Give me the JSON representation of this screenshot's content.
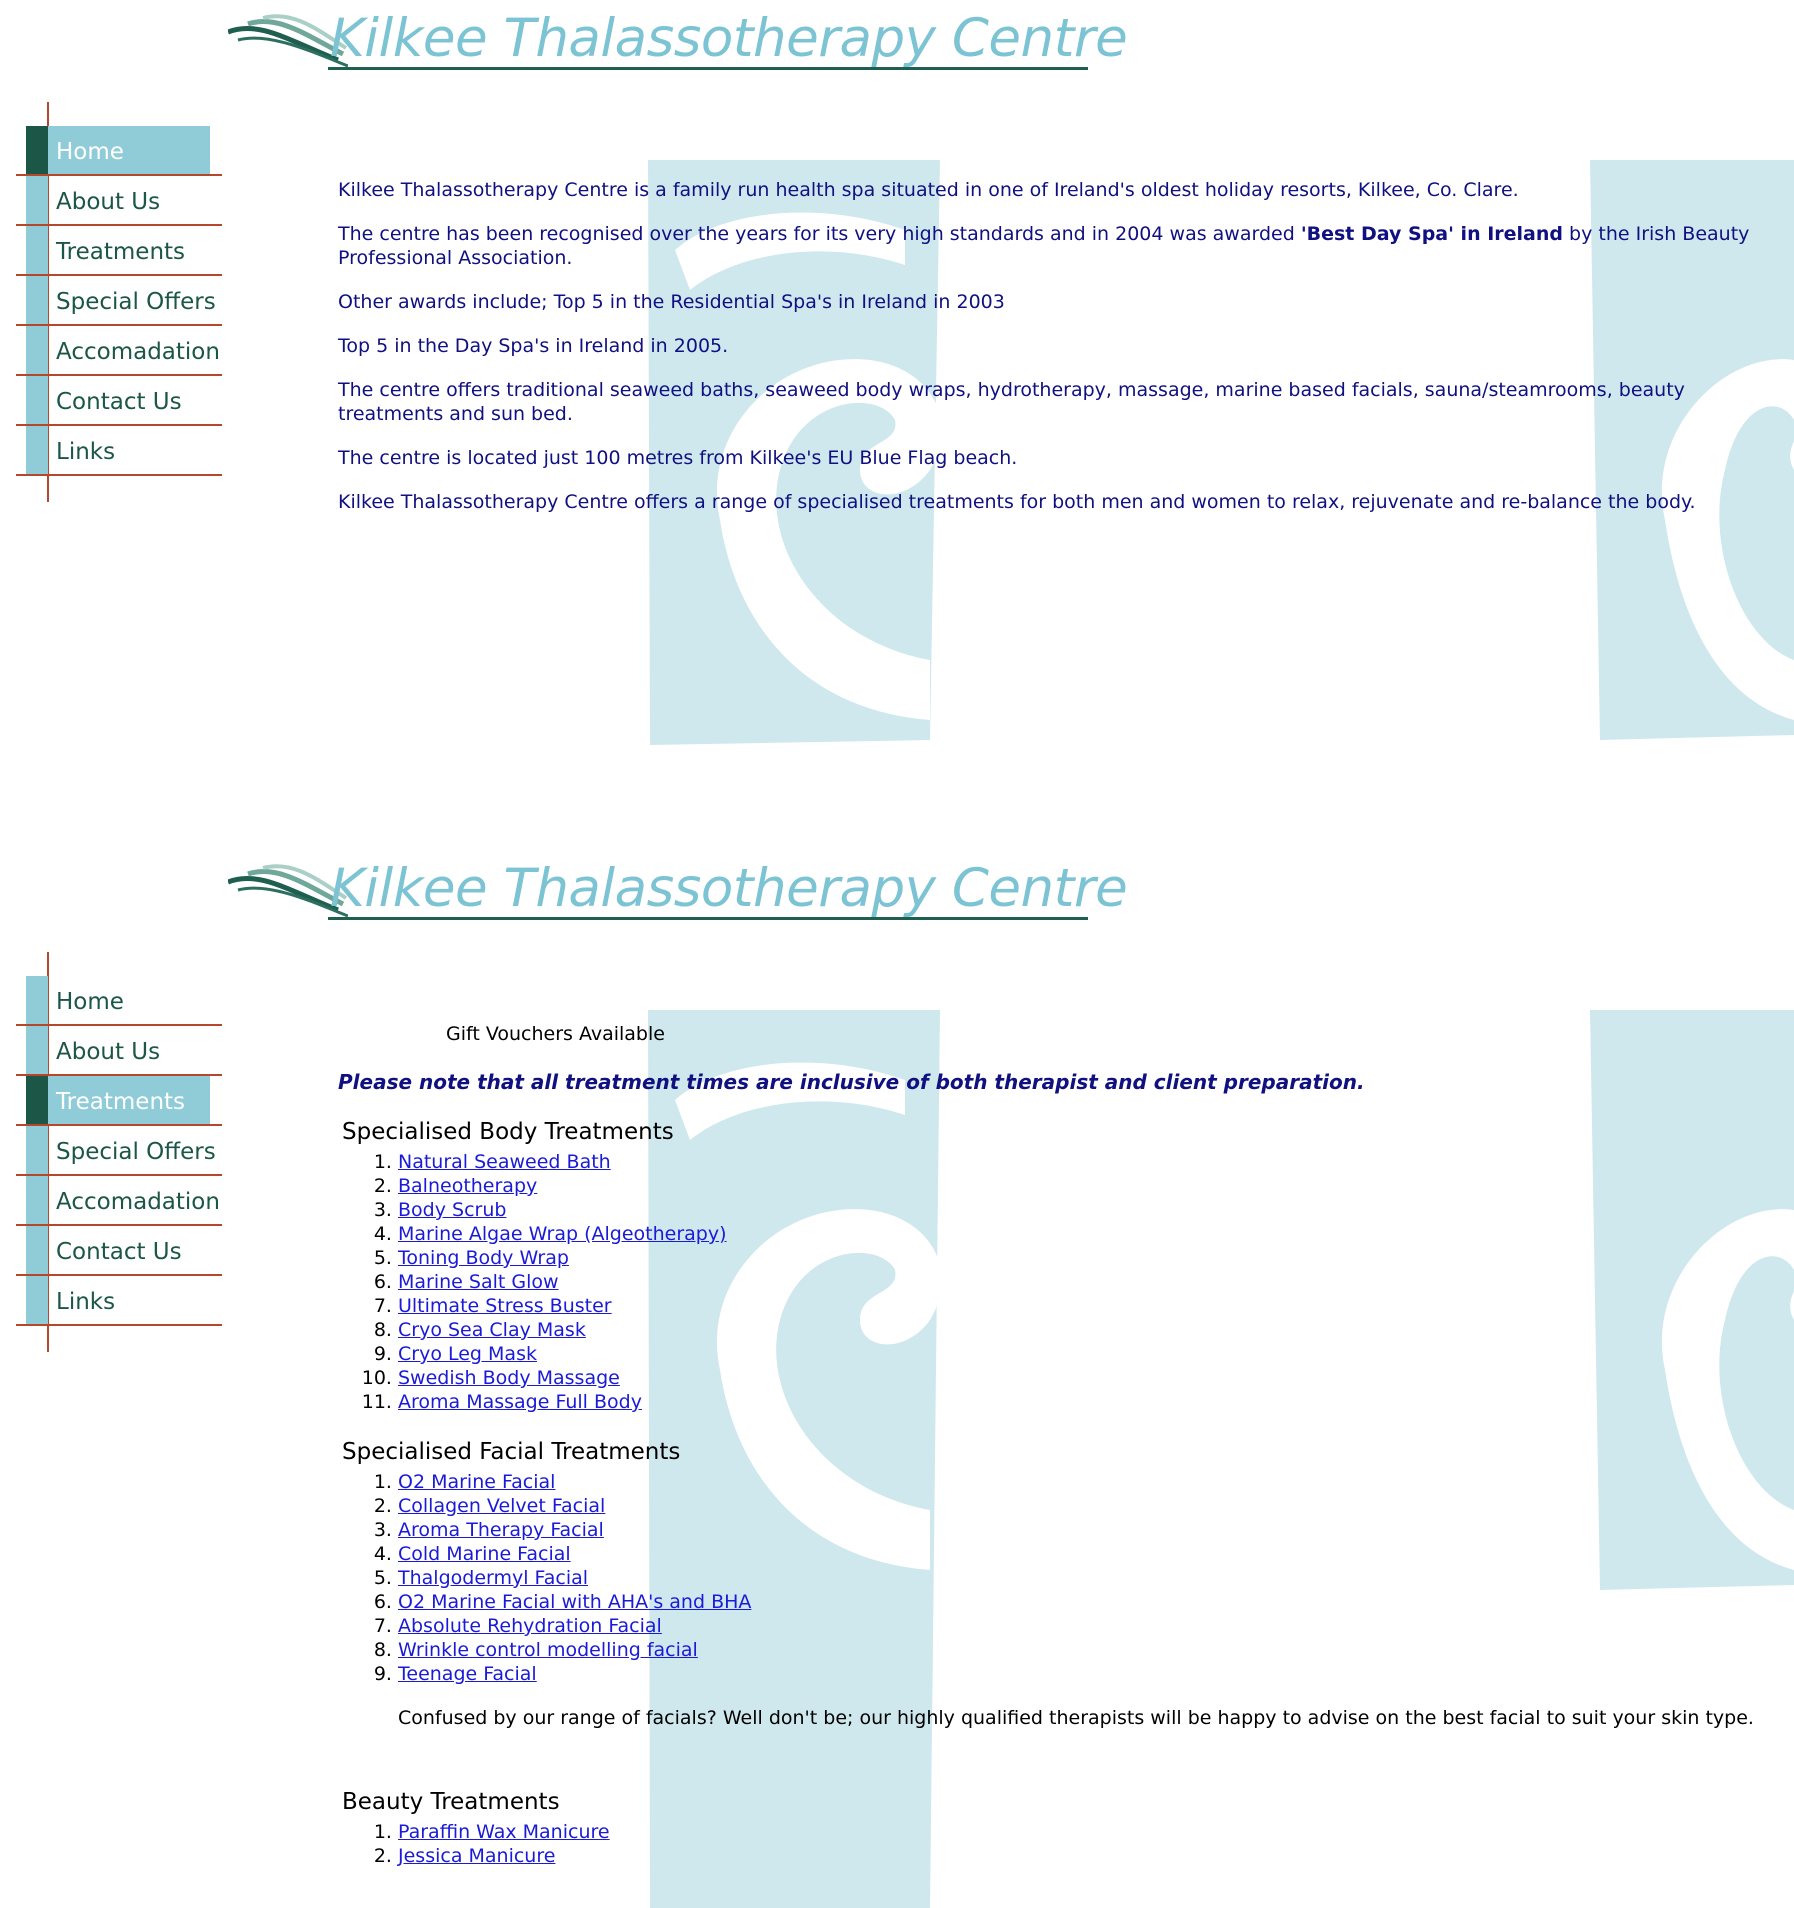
{
  "site": {
    "logo_text": "Kilkee Thalassotherapy Centre"
  },
  "nav": {
    "home": "Home",
    "about": "About Us",
    "treatments": "Treatments",
    "offers": "Special Offers",
    "accom": "Accomadation",
    "contact": "Contact Us",
    "links": "Links"
  },
  "home": {
    "p1": "Kilkee Thalassotherapy Centre is a family run health spa situated in one of Ireland's oldest holiday resorts, Kilkee, Co. Clare.",
    "p2_pre": "The centre has been recognised over the years for its very high standards and in 2004 was awarded ",
    "p2_bold": "'Best Day Spa' in Ireland",
    "p2_post": " by the Irish Beauty Professional Association.",
    "p3": "Other awards include; Top 5 in the Residential Spa's in Ireland in 2003",
    "p4": "Top 5  in the Day Spa's in Ireland in 2005.",
    "p5": "The centre offers traditional seaweed baths, seaweed body wraps, hydrotherapy, massage, marine based facials, sauna/steamrooms, beauty treatments and sun bed.",
    "p6": "The centre is located just 100 metres from Kilkee's EU Blue Flag beach.",
    "p7": "Kilkee Thalassotherapy Centre offers a range of specialised treatments for both men and women to relax, rejuvenate and re-balance the body."
  },
  "treatments": {
    "gift": "Gift Vouchers Available",
    "note": "Please note that all treatment times are inclusive of both therapist and client preparation.",
    "body_heading": "Specialised Body Treatments",
    "body": [
      "Natural Seaweed Bath",
      "Balneotherapy",
      "Body Scrub",
      "Marine Algae Wrap (Algeotherapy)",
      "Toning Body Wrap",
      "Marine Salt Glow",
      "Ultimate Stress Buster",
      "Cryo Sea Clay Mask",
      "Cryo Leg Mask",
      "Swedish Body Massage",
      "Aroma Massage Full Body"
    ],
    "facial_heading": "Specialised Facial Treatments",
    "facial": [
      "O2 Marine Facial",
      "Collagen Velvet Facial",
      "Aroma Therapy Facial",
      "Cold Marine Facial",
      "Thalgodermyl Facial",
      "O2 Marine Facial with AHA's and BHA",
      "Absolute Rehydration Facial",
      "Wrinkle control modelling facial",
      "Teenage Facial"
    ],
    "confused": "Confused by our range of facials? Well don't be; our highly qualified therapists will be happy to advise on the best facial to suit your skin type.",
    "beauty_heading": "Beauty Treatments",
    "beauty": [
      "Paraffin Wax Manicure",
      "Jessica Manicure"
    ]
  },
  "colors": {
    "nav_bar": "#8fccd8",
    "nav_active": "#1c5646",
    "nav_line": "#b5472c",
    "text_navy": "#101080",
    "link": "#1a1ad8",
    "watermark": "#c7e4ea"
  }
}
